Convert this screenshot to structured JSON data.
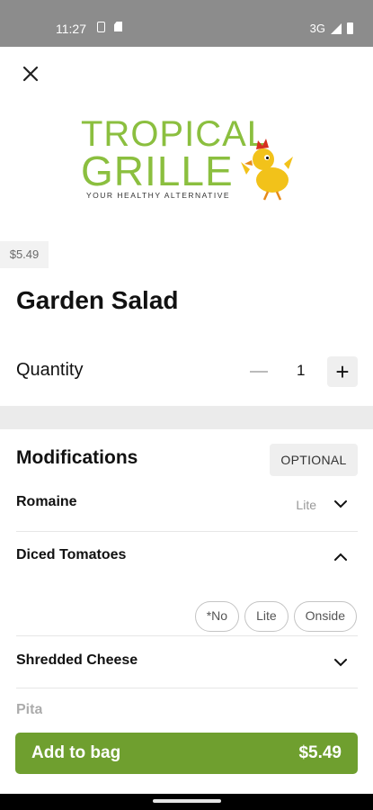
{
  "status": {
    "time": "11:27",
    "network": "3G"
  },
  "logo": {
    "line1": "TROPICAL",
    "line2": "GRILLE",
    "tagline": "YOUR HEALTHY ALTERNATIVE"
  },
  "item": {
    "price": "$5.49",
    "name": "Garden Salad"
  },
  "quantity": {
    "label": "Quantity",
    "value": "1",
    "plus": "+"
  },
  "modifications": {
    "title": "Modifications",
    "badge": "OPTIONAL",
    "items": [
      {
        "name": "Romaine",
        "selected": "Lite",
        "expanded": false
      },
      {
        "name": "Diced Tomatoes",
        "selected": "",
        "expanded": true,
        "options": [
          "*No",
          "Lite",
          "Onside"
        ]
      },
      {
        "name": "Shredded Cheese",
        "selected": "",
        "expanded": false
      }
    ],
    "partial_next": "Pita"
  },
  "cta": {
    "label": "Add to bag",
    "amount": "$5.49"
  },
  "colors": {
    "accent": "#6f9f2f",
    "logo_green": "#8bbf3f",
    "status_bar": "#8c8c8c"
  }
}
